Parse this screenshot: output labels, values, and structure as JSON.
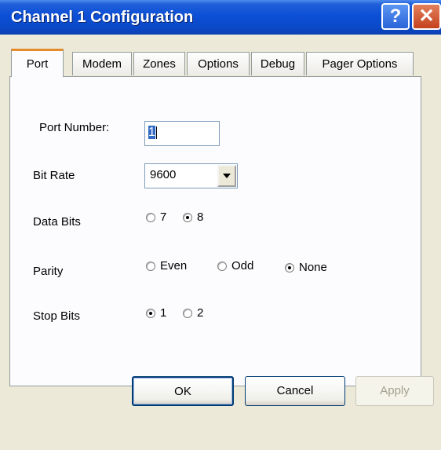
{
  "window": {
    "title": "Channel 1 Configuration",
    "help_button": "?",
    "close_button": "✕"
  },
  "tabs": [
    {
      "label": "Port",
      "active": true
    },
    {
      "label": "Modem",
      "active": false
    },
    {
      "label": "Zones",
      "active": false
    },
    {
      "label": "Options",
      "active": false
    },
    {
      "label": "Debug",
      "active": false
    },
    {
      "label": "Pager Options",
      "active": false
    }
  ],
  "port_number": {
    "label": "Port Number:",
    "value": "1"
  },
  "bit_rate": {
    "label": "Bit Rate",
    "value": "9600"
  },
  "data_bits": {
    "label": "Data Bits",
    "options": [
      {
        "label": "7",
        "selected": false
      },
      {
        "label": "8",
        "selected": true
      }
    ]
  },
  "parity": {
    "label": "Parity",
    "options": [
      {
        "label": "Even",
        "selected": false
      },
      {
        "label": "Odd",
        "selected": false
      },
      {
        "label": "None",
        "selected": true
      }
    ]
  },
  "stop_bits": {
    "label": "Stop Bits",
    "options": [
      {
        "label": "1",
        "selected": true
      },
      {
        "label": "2",
        "selected": false
      }
    ]
  },
  "buttons": {
    "ok": "OK",
    "cancel": "Cancel",
    "apply": "Apply"
  }
}
